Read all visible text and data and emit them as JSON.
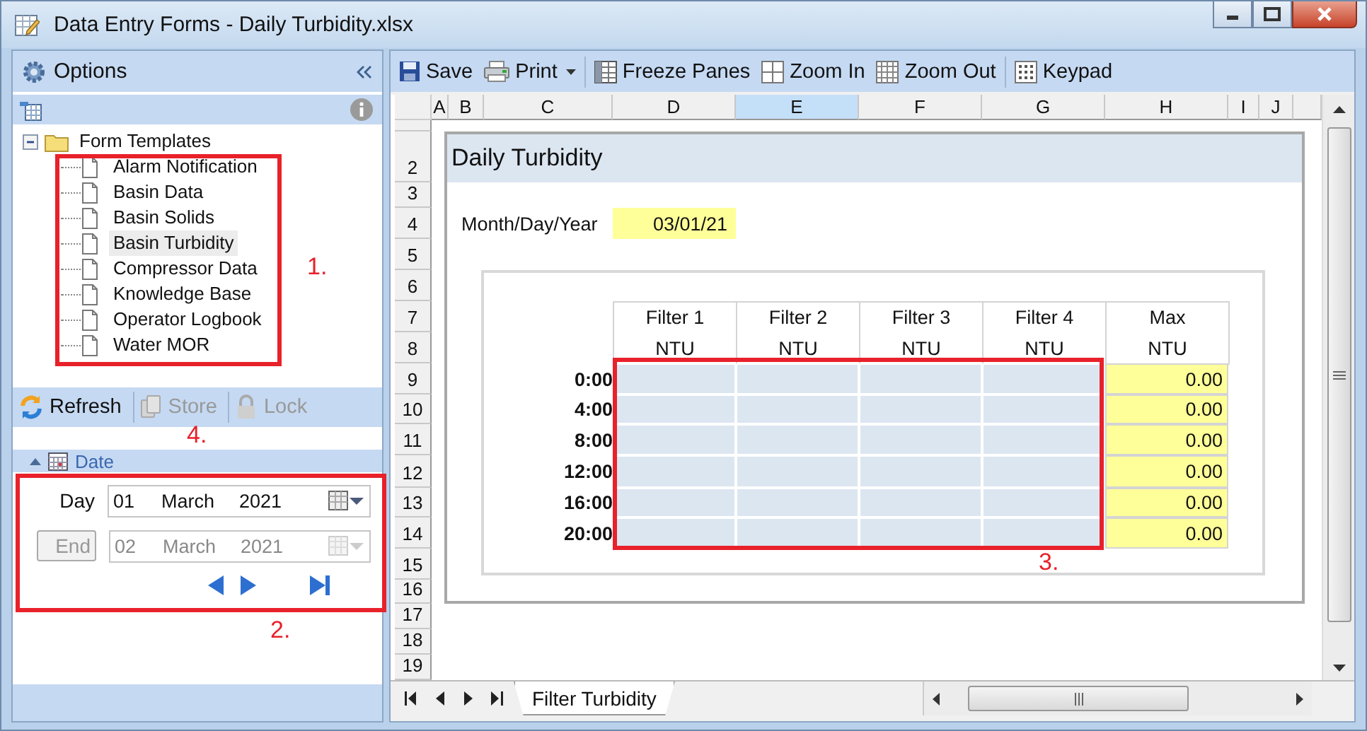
{
  "window": {
    "title": "Data Entry Forms - Daily Turbidity.xlsx"
  },
  "options_panel": {
    "title": "Options",
    "tree": {
      "label": "Form Templates",
      "expanded": true,
      "children": [
        {
          "label": "Alarm Notification",
          "selected": false
        },
        {
          "label": "Basin Data",
          "selected": false
        },
        {
          "label": "Basin Solids",
          "selected": false
        },
        {
          "label": "Basin Turbidity",
          "selected": true
        },
        {
          "label": "Compressor Data",
          "selected": false
        },
        {
          "label": "Knowledge Base",
          "selected": false
        },
        {
          "label": "Operator Logbook",
          "selected": false
        },
        {
          "label": "Water MOR",
          "selected": false
        }
      ]
    },
    "toolbar": [
      {
        "label": "Refresh",
        "kind": "refresh",
        "disabled": false
      },
      {
        "label": "Store",
        "kind": "store",
        "disabled": true
      },
      {
        "label": "Lock",
        "kind": "lock",
        "disabled": true
      }
    ],
    "date_section": {
      "title": "Date",
      "expanded": true,
      "day": {
        "label": "Day",
        "day": "01",
        "month": "March",
        "year": "2021",
        "disabled": false
      },
      "end": {
        "label": "End",
        "day": "02",
        "month": "March",
        "year": "2021",
        "disabled": true
      }
    }
  },
  "toolbar": {
    "groups": [
      {
        "items": [
          {
            "label": "Save",
            "kind": "save",
            "dropdown": false
          },
          {
            "label": "Print",
            "kind": "print",
            "dropdown": true
          }
        ]
      },
      {
        "items": [
          {
            "label": "Freeze Panes",
            "kind": "freeze",
            "dropdown": false
          },
          {
            "label": "Zoom In",
            "kind": "zoom_in",
            "dropdown": false
          },
          {
            "label": "Zoom Out",
            "kind": "zoom_out",
            "dropdown": false
          }
        ]
      },
      {
        "items": [
          {
            "label": "Keypad",
            "kind": "keypad",
            "dropdown": false
          }
        ]
      }
    ]
  },
  "sheet": {
    "columns": [
      {
        "label": "A",
        "selected": false
      },
      {
        "label": "B",
        "selected": false
      },
      {
        "label": "C",
        "selected": false
      },
      {
        "label": "D",
        "selected": false
      },
      {
        "label": "E",
        "selected": true
      },
      {
        "label": "F",
        "selected": false
      },
      {
        "label": "G",
        "selected": false
      },
      {
        "label": "H",
        "selected": false
      },
      {
        "label": "I",
        "selected": false
      },
      {
        "label": "J",
        "selected": false
      }
    ],
    "rows": [
      "2",
      "3",
      "4",
      "5",
      "6",
      "7",
      "8",
      "9",
      "10",
      "11",
      "12",
      "13",
      "14",
      "15",
      "16",
      "17",
      "18",
      "19"
    ],
    "form": {
      "title": "Daily Turbidity",
      "date_label": "Month/Day/Year",
      "date_value": "03/01/21",
      "columns": [
        {
          "label": "Filter 1",
          "unit": "NTU"
        },
        {
          "label": "Filter 2",
          "unit": "NTU"
        },
        {
          "label": "Filter 3",
          "unit": "NTU"
        },
        {
          "label": "Filter 4",
          "unit": "NTU"
        },
        {
          "label": "Max",
          "unit": "NTU"
        }
      ],
      "rows": [
        {
          "time": "0:00",
          "max": "0.00"
        },
        {
          "time": "4:00",
          "max": "0.00"
        },
        {
          "time": "8:00",
          "max": "0.00"
        },
        {
          "time": "12:00",
          "max": "0.00"
        },
        {
          "time": "16:00",
          "max": "0.00"
        },
        {
          "time": "20:00",
          "max": "0.00"
        }
      ]
    },
    "tabs": [
      {
        "label": "Filter Turbidity",
        "selected": true
      }
    ]
  },
  "annotations": [
    {
      "label": "1.",
      "kind": "boxed"
    },
    {
      "label": "2.",
      "kind": "boxed"
    },
    {
      "label": "3.",
      "kind": "boxed"
    },
    {
      "label": "4.",
      "kind": "label"
    }
  ]
}
